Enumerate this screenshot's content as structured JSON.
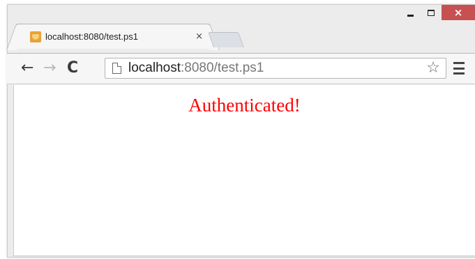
{
  "browser": {
    "tab": {
      "title": "localhost:8080/test.ps1",
      "close_glyph": "×",
      "favicon": "localhost-favicon-icon"
    },
    "toolbar": {
      "back_glyph": "←",
      "forward_glyph": "→",
      "reload_glyph": "C",
      "url_host": "localhost",
      "url_rest": ":8080/test.ps1",
      "bookmark_glyph": "☆"
    },
    "window_controls": {
      "close_glyph": "×"
    }
  },
  "page": {
    "message": "Authenticated!",
    "message_color": "#ff0000"
  },
  "colors": {
    "close_button": "#c75050",
    "frame": "#ececec"
  }
}
